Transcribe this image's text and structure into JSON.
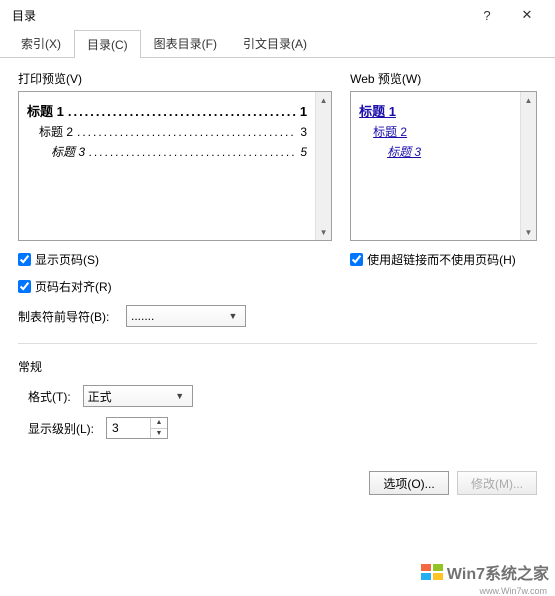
{
  "titlebar": {
    "title": "目录",
    "help": "?",
    "close": "✕"
  },
  "tabs": {
    "index": "索引(X)",
    "toc": "目录(C)",
    "figures": "图表目录(F)",
    "citations": "引文目录(A)"
  },
  "print_preview": {
    "label": "打印预览(V)",
    "lines": [
      {
        "text": "标题 1",
        "page": "1"
      },
      {
        "text": "标题 2",
        "page": "3"
      },
      {
        "text": "标题 3",
        "page": "5"
      }
    ]
  },
  "web_preview": {
    "label": "Web 预览(W)",
    "lines": [
      "标题 1",
      "标题 2",
      "标题 3"
    ]
  },
  "checkboxes": {
    "show_page_numbers": "显示页码(S)",
    "right_align": "页码右对齐(R)",
    "use_hyperlinks": "使用超链接而不使用页码(H)"
  },
  "leader": {
    "label": "制表符前导符(B):",
    "value": "......."
  },
  "general": {
    "section": "常规",
    "format_label": "格式(T):",
    "format_value": "正式",
    "levels_label": "显示级别(L):",
    "levels_value": "3"
  },
  "footer": {
    "options": "选项(O)...",
    "modify": "修改(M)..."
  },
  "watermark": {
    "text": "Win7系统之家",
    "sub": "www.Win7w.com"
  },
  "dots": "..........................................."
}
